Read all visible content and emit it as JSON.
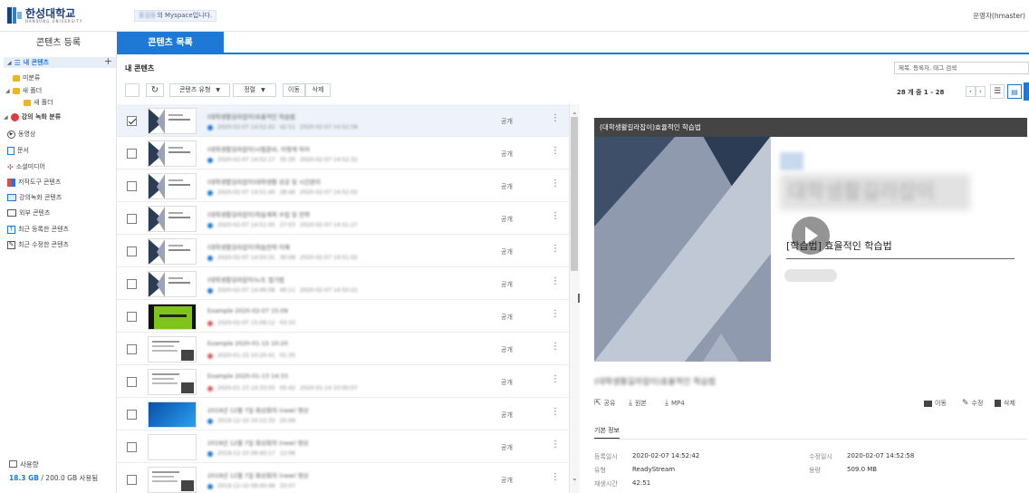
{
  "header": {
    "logo_text": "한성대학교",
    "logo_sub": "HANSUNG UNIVERSITY",
    "myspace_owner": "홍길동",
    "myspace_suffix": "의 Myspace입니다.",
    "user": "운영자(hmaster)",
    "brand_color": "#1e79d6"
  },
  "tabs": [
    {
      "label": "콘텐츠 등록",
      "active": false
    },
    {
      "label": "콘텐츠 목록",
      "active": true
    }
  ],
  "sidebar": {
    "my_contents": "내 콘텐츠",
    "add_label": "+",
    "folders": [
      "미분류",
      "새 폴더",
      "새 폴더"
    ],
    "lecture_label": "강의 녹화 분류",
    "categories": [
      "동영상",
      "문서",
      "소셜미디어",
      "저작도구 콘텐츠",
      "강의녹화 콘텐츠",
      "외부 콘텐츠",
      "최근 등록한 콘텐츠",
      "최근 수정한 콘텐츠"
    ],
    "storage_label": "사용량",
    "storage_used": "18.3 GB",
    "storage_total": " / 200.0 GB 사용됨"
  },
  "main": {
    "title": "내 콘텐츠",
    "search_placeholder": "제목, 등록자, 태그 검색",
    "toolbar": {
      "type_label": "콘텐츠 유형",
      "sort_label": "정렬",
      "move_label": "이동",
      "delete_label": "삭제"
    },
    "count_text": "28 개 중 1 - 28",
    "rows": [
      {
        "title": "(대학생활길라잡이)효율적인 학습법",
        "meta1": "2020-02-07 14:52:42",
        "meta2": "42:51",
        "meta3": "2020-02-07 14:52:58",
        "visibility": "공개",
        "checked": true,
        "thumb": "slide",
        "dot": "#1e79d6"
      },
      {
        "title": "(대학생활길라잡이)시험준비, 이렇게 하자",
        "meta1": "2020-02-07 14:52:17",
        "meta2": "35:30",
        "meta3": "2020-02-07 14:52:32",
        "visibility": "공개",
        "checked": false,
        "thumb": "slide",
        "dot": "#1e79d6"
      },
      {
        "title": "(대학생활길라잡이)대학생활 성공 및 시간관리",
        "meta1": "2020-02-07 14:51:40",
        "meta2": "28:46",
        "meta3": "2020-02-07 14:52:02",
        "visibility": "공개",
        "checked": false,
        "thumb": "slide",
        "dot": "#1e79d6"
      },
      {
        "title": "(대학생활길라잡이)학습계획 수립 및 전략",
        "meta1": "2020-02-07 14:51:05",
        "meta2": "27:03",
        "meta3": "2020-02-07 14:51:27",
        "visibility": "공개",
        "checked": false,
        "thumb": "slide",
        "dot": "#1e79d6"
      },
      {
        "title": "(대학생활길라잡이)학습전략 이해",
        "meta1": "2020-02-07 14:50:31",
        "meta2": "30:08",
        "meta3": "2020-02-07 14:51:02",
        "visibility": "공개",
        "checked": false,
        "thumb": "slide",
        "dot": "#1e79d6"
      },
      {
        "title": "(대학생활길라잡이)노트 필기법",
        "meta1": "2020-02-07 14:49:58",
        "meta2": "40:11",
        "meta3": "2020-02-07 14:50:22",
        "visibility": "공개",
        "checked": false,
        "thumb": "slide",
        "dot": "#1e79d6"
      },
      {
        "title": "Example 2020-02-07 15:09",
        "meta1": "2020-02-07 15:09:12",
        "meta2": "03:10",
        "meta3": "",
        "visibility": "공개",
        "checked": false,
        "thumb": "green",
        "dot": "#e05a5a"
      },
      {
        "title": "Example 2020-01-15 10:20",
        "meta1": "2020-01-15 10:20:41",
        "meta2": "01:35",
        "meta3": "",
        "visibility": "공개",
        "checked": false,
        "thumb": "doc",
        "dot": "#e05a5a"
      },
      {
        "title": "Example 2020-01-13 14:33",
        "meta1": "2020-01-13 14:33:05",
        "meta2": "05:42",
        "meta3": "2020-01-14 10:00:07",
        "visibility": "공개",
        "checked": false,
        "thumb": "doc",
        "dot": "#e05a5a"
      },
      {
        "title": "2019년 12월 7일 화상회의 (new) 영상",
        "meta1": "2019-12-10 10:12:33",
        "meta2": "25:09",
        "meta3": "",
        "visibility": "공개",
        "checked": false,
        "thumb": "blue",
        "dot": "#1e79d6"
      },
      {
        "title": "2019년 12월 7일 화상회의 (new) 영상",
        "meta1": "2019-12-10 09:40:17",
        "meta2": "12:06",
        "meta3": "",
        "visibility": "공개",
        "checked": false,
        "thumb": "white",
        "dot": "#1e79d6"
      },
      {
        "title": "2019년 12월 7일 화상회의 (new) 영상",
        "meta1": "2019-12-10 09:00:49",
        "meta2": "33:07",
        "meta3": "",
        "visibility": "공개",
        "checked": false,
        "thumb": "doc2",
        "dot": "#1e79d6"
      }
    ]
  },
  "detail": {
    "title_bar": "(대학생활길라잡이)효율적인 학습법",
    "slide_heading": "대학생활길라잡이",
    "slide_title": "[학습법] 효율적인 학습법",
    "content_title": "(대학생활길라잡이)효율적인 학습법",
    "actions": {
      "share": "공유",
      "original": "원본",
      "mp4": "MP4",
      "move": "이동",
      "edit": "수정",
      "delete": "삭제"
    },
    "info_tab": "기본 정보",
    "info": {
      "created_label": "등록일시",
      "created_value": "2020-02-07 14:52:42",
      "modified_label": "수정일시",
      "modified_value": "2020-02-07 14:52:58",
      "type_label": "유형",
      "type_value": "ReadyStream",
      "size_label": "용량",
      "size_value": "509.0 MB",
      "duration_label": "재생시간",
      "duration_value": "42:51"
    }
  }
}
